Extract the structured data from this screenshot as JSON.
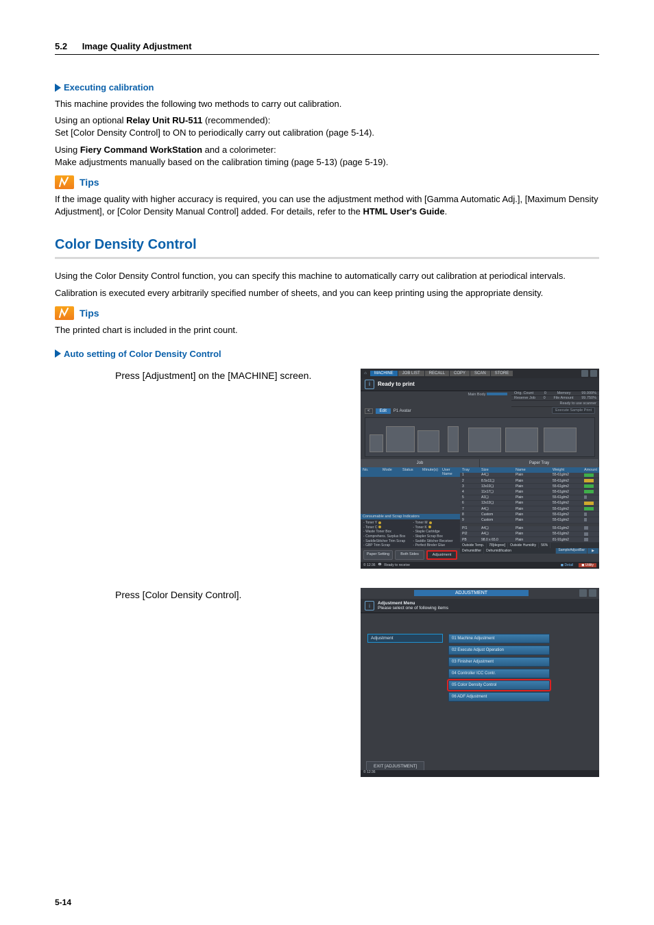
{
  "header": {
    "section_num": "5.2",
    "section_title": "Image Quality Adjustment"
  },
  "h_exec": "Executing calibration",
  "p1": "This machine provides the following two methods to carry out calibration.",
  "p2a": "Using an optional ",
  "p2b": "Relay Unit RU-511",
  "p2c": " (recommended):",
  "p2d": "Set [Color Density Control] to ON to periodically carry out calibration (page 5-14).",
  "p3a": "Using ",
  "p3b": "Fiery Command WorkStation",
  "p3c": " and a colorimeter:",
  "p3d": "Make adjustments manually based on the calibration timing (page 5-13) (page 5-19).",
  "tips_label": "Tips",
  "tips1a": "If the image quality with higher accuracy is required, you can use the adjustment method with [Gamma Automatic Adj.], [Maximum Density Adjustment], or [Color Density Manual Control] added. For details, refer to the ",
  "tips1b": "HTML User's Guide",
  "tips1c": ".",
  "h_cdc": "Color Density Control",
  "cdc_p1": "Using the Color Density Control function, you can specify this machine to automatically carry out calibration at periodical intervals.",
  "cdc_p2": "Calibration is executed every arbitrarily specified number of sheets, and you can keep printing using the appropriate density.",
  "tips2": "The printed chart is included in the print count.",
  "h_auto": "Auto setting of Color Density Control",
  "step1": "Press [Adjustment] on the [MACHINE] screen.",
  "step2": "Press [Color Density Control].",
  "page_num": "5-14",
  "machine": {
    "tabs": [
      "MACHINE",
      "JOB LIST",
      "RECALL",
      "COPY",
      "SCAN",
      "STORE"
    ],
    "ready": "Ready to print",
    "main_body": "Main Body",
    "mem_rows": [
      {
        "k": "Orig. Count",
        "v": "0",
        "k2": "Memory",
        "v2": "99.999%"
      },
      {
        "k": "Reserve Job",
        "v": "0",
        "k2": "File Amount",
        "v2": "99.750%"
      }
    ],
    "ready_scanner": "Ready to use scanner",
    "sample_btn": "Execute Sample Print",
    "avatar_label": "P1 Avatar",
    "avatar_edit": "Edit",
    "left_title": "Job",
    "right_title": "Paper Tray",
    "job_cols": [
      "No.",
      "Mode",
      "Status",
      "Minute(s)",
      "User Name"
    ],
    "pt_cols": [
      "Tray",
      "Size",
      "Name",
      "Weight",
      "Amount"
    ],
    "paper_rows": [
      {
        "tray": "1",
        "size": "A4❏",
        "name": "Plain",
        "wt": "55-61g/m2",
        "amt": "g",
        "w": 14
      },
      {
        "tray": "2",
        "size": "8.5x11❏",
        "name": "Plain",
        "wt": "55-61g/m2",
        "amt": "y",
        "w": 14
      },
      {
        "tray": "3",
        "size": "13x19❏",
        "name": "Plain",
        "wt": "55-61g/m2",
        "amt": "g",
        "w": 14
      },
      {
        "tray": "4",
        "size": "11x17❏",
        "name": "Plain",
        "wt": "55-61g/m2",
        "amt": "g",
        "w": 14
      },
      {
        "tray": "5",
        "size": "A3❏",
        "name": "Plain",
        "wt": "55-61g/m2",
        "amt": "gr",
        "w": 4
      },
      {
        "tray": "6",
        "size": "13x19❏",
        "name": "Plain",
        "wt": "55-61g/m2",
        "amt": "y",
        "w": 14
      },
      {
        "tray": "7",
        "size": "A4❏",
        "name": "Plain",
        "wt": "55-61g/m2",
        "amt": "g",
        "w": 14
      },
      {
        "tray": "8",
        "size": "Custom",
        "name": "Plain",
        "wt": "55-61g/m2",
        "amt": "gr",
        "w": 4
      },
      {
        "tray": "9",
        "size": "Custom",
        "name": "Plain",
        "wt": "55-61g/m2",
        "amt": "gr",
        "w": 4
      }
    ],
    "paper_rows2": [
      {
        "tray": "PI1",
        "size": "A4❏",
        "name": "Plain",
        "wt": "55-61g/m2",
        "amt": "gr",
        "w": 6
      },
      {
        "tray": "PI2",
        "size": "A4❏",
        "name": "Plain",
        "wt": "55-61g/m2",
        "amt": "gr",
        "w": 6
      },
      {
        "tray": "PB",
        "size": "98.0 x 65.0",
        "name": "Plain",
        "wt": "81-91g/m2",
        "amt": "gr",
        "w": 6
      }
    ],
    "outside": {
      "temp_l": "Outside Temp.",
      "temp_v": "78[degree]",
      "hum_l": "Outside Humidity",
      "hum_v": "56%"
    },
    "dehum": {
      "l": "Dehumidifier",
      "v": "Dehumidification"
    },
    "scrap_title": "Consumable and Scrap Indicators",
    "scrap_left": [
      "Toner Y",
      "Toner C",
      "Waste Toner Box",
      "Comprehens. Surplus Box",
      "SaddleStitcher Trim Scrap",
      "GBP Trim Scrap"
    ],
    "scrap_right": [
      "Toner M",
      "Toner K",
      "Staple Cartridge",
      "Stapler Scrap Box",
      "Saddle Stitcher Receiver",
      "Perfect Binder Glue"
    ],
    "bottom_btns": [
      "Paper Setting",
      "Both Sides",
      "Adjustment"
    ],
    "sample_adj": "SampleAdjustBar",
    "status_time": "© 12:36",
    "status_text": "Ready to receive",
    "status_detail": "Detail",
    "status_util": "Utility"
  },
  "adj": {
    "tab": "ADJUSTMENT",
    "menu_title": "Adjustment Menu",
    "menu_sub": "Please select one of following items",
    "left_btn": "Adjustment",
    "items": [
      "01 Machine Adjustment",
      "02 Execute Adjust Operation",
      "03 Finisher Adjustment",
      "04 Controller ICC Contr.",
      "05 Color Density Control",
      "06 ADF Adjustment"
    ],
    "highlight_index": 4,
    "exit": "EXIT [ADJUSTMENT]",
    "footer_time": "© 12:36"
  }
}
